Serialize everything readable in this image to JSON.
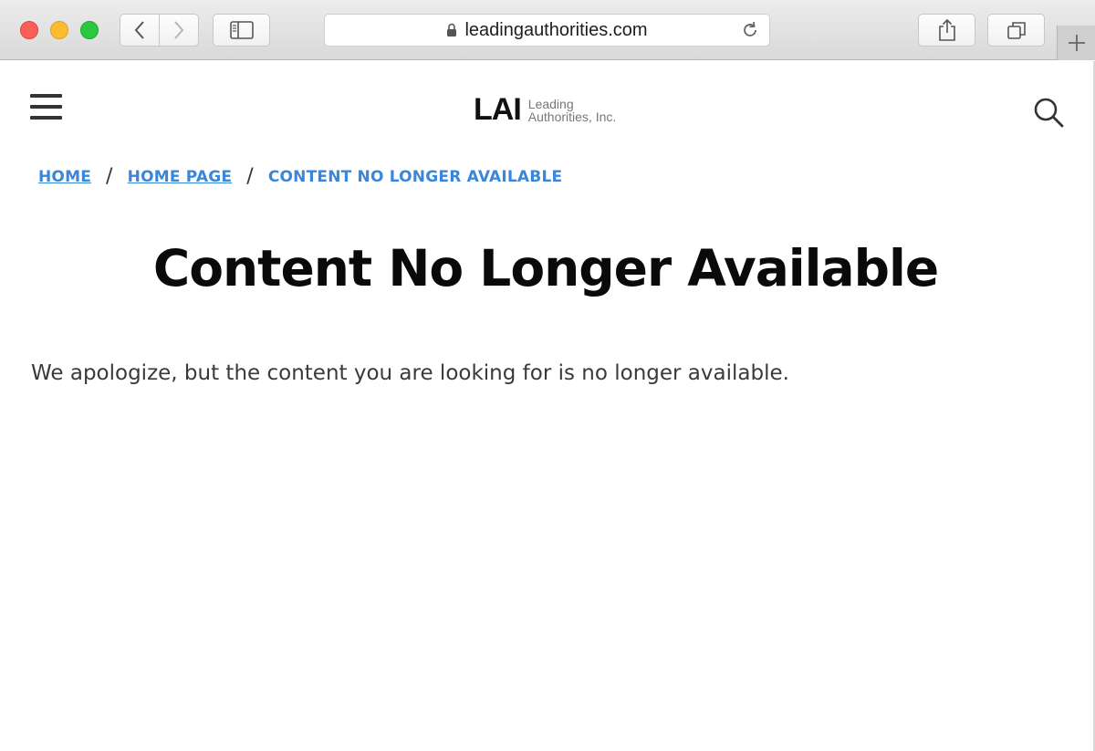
{
  "browser": {
    "url": "leadingauthorities.com"
  },
  "site": {
    "logo_mark": "LAI",
    "logo_line1": "Leading",
    "logo_line2": "Authorities, Inc."
  },
  "breadcrumb": {
    "items": [
      {
        "label": "HOME"
      },
      {
        "label": "HOME PAGE"
      }
    ],
    "separator": "/",
    "current": "CONTENT NO LONGER AVAILABLE"
  },
  "main": {
    "title": "Content No Longer Available",
    "message": "We apologize, but the content you are looking for is no longer available."
  },
  "colors": {
    "link": "#3a86d8",
    "title": "#0a0a0a",
    "body_text": "#3a3a3a"
  },
  "icons": [
    "close-icon",
    "minimize-icon",
    "zoom-icon",
    "back-icon",
    "forward-icon",
    "sidebar-icon",
    "lock-icon",
    "reload-icon",
    "share-icon",
    "tabs-icon",
    "new-tab-icon",
    "hamburger-menu-icon",
    "search-icon"
  ]
}
